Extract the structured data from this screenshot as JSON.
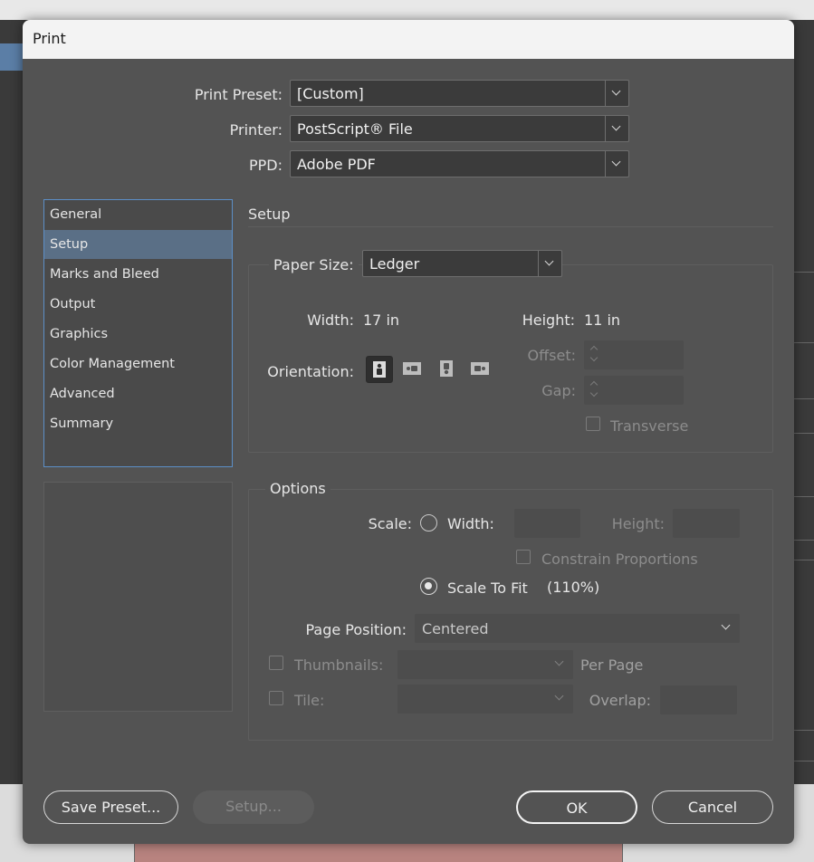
{
  "dialog": {
    "title": "Print"
  },
  "top_fields": {
    "print_preset": {
      "label": "Print Preset:",
      "value": "[Custom]"
    },
    "printer": {
      "label": "Printer:",
      "value": "PostScript® File"
    },
    "ppd": {
      "label": "PPD:",
      "value": "Adobe PDF"
    }
  },
  "sidebar": {
    "items": [
      {
        "label": "General"
      },
      {
        "label": "Setup"
      },
      {
        "label": "Marks and Bleed"
      },
      {
        "label": "Output"
      },
      {
        "label": "Graphics"
      },
      {
        "label": "Color Management"
      },
      {
        "label": "Advanced"
      },
      {
        "label": "Summary"
      }
    ],
    "selected": "Setup"
  },
  "setup": {
    "section_title": "Setup",
    "paper_size": {
      "label": "Paper Size:",
      "value": "Ledger"
    },
    "width": {
      "label": "Width:",
      "value": "17 in"
    },
    "height": {
      "label": "Height:",
      "value": "11 in"
    },
    "orientation": {
      "label": "Orientation:",
      "options": [
        "portrait-icon",
        "landscape-icon",
        "reverse-portrait-icon",
        "reverse-landscape-icon"
      ],
      "selected": "portrait"
    },
    "offset": {
      "label": "Offset:",
      "value": ""
    },
    "gap": {
      "label": "Gap:",
      "value": ""
    },
    "transverse": {
      "label": "Transverse",
      "checked": false
    }
  },
  "options": {
    "section_title": "Options",
    "scale_label": "Scale:",
    "width_label": "Width:",
    "width_value": "",
    "height_label": "Height:",
    "height_value": "",
    "constrain_label": "Constrain Proportions",
    "scale_to_fit_label": "Scale To Fit",
    "scale_to_fit_value": "(110%)",
    "page_position": {
      "label": "Page Position:",
      "value": "Centered"
    },
    "thumbnails": {
      "label": "Thumbnails:",
      "value": "",
      "suffix": "Per Page"
    },
    "tile": {
      "label": "Tile:",
      "value": "",
      "overlap_label": "Overlap:",
      "overlap_value": ""
    }
  },
  "buttons": {
    "save_preset": "Save Preset...",
    "setup": "Setup...",
    "ok": "OK",
    "cancel": "Cancel"
  },
  "colors": {
    "dialog_bg": "#535353",
    "selection": "#5a6f86",
    "focus_border": "#5c8fc7"
  }
}
